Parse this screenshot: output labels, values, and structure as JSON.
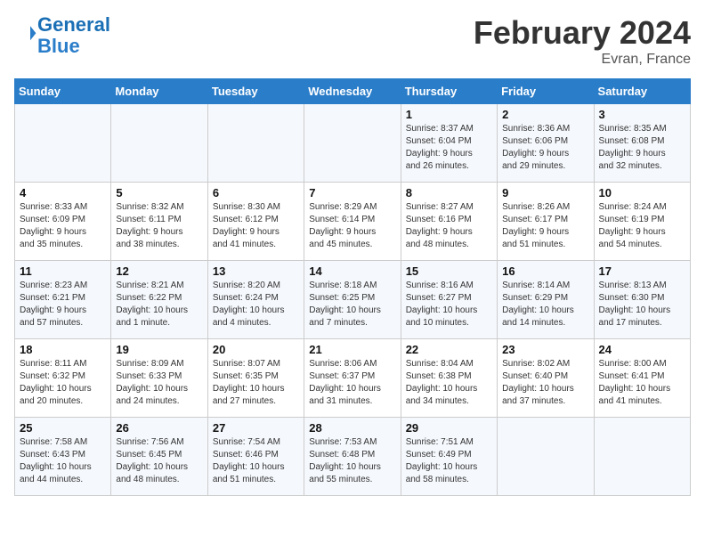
{
  "header": {
    "logo_line1": "General",
    "logo_line2": "Blue",
    "title": "February 2024",
    "subtitle": "Evran, France"
  },
  "columns": [
    "Sunday",
    "Monday",
    "Tuesday",
    "Wednesday",
    "Thursday",
    "Friday",
    "Saturday"
  ],
  "weeks": [
    {
      "days": [
        {
          "num": "",
          "info": ""
        },
        {
          "num": "",
          "info": ""
        },
        {
          "num": "",
          "info": ""
        },
        {
          "num": "",
          "info": ""
        },
        {
          "num": "1",
          "info": "Sunrise: 8:37 AM\nSunset: 6:04 PM\nDaylight: 9 hours\nand 26 minutes."
        },
        {
          "num": "2",
          "info": "Sunrise: 8:36 AM\nSunset: 6:06 PM\nDaylight: 9 hours\nand 29 minutes."
        },
        {
          "num": "3",
          "info": "Sunrise: 8:35 AM\nSunset: 6:08 PM\nDaylight: 9 hours\nand 32 minutes."
        }
      ]
    },
    {
      "days": [
        {
          "num": "4",
          "info": "Sunrise: 8:33 AM\nSunset: 6:09 PM\nDaylight: 9 hours\nand 35 minutes."
        },
        {
          "num": "5",
          "info": "Sunrise: 8:32 AM\nSunset: 6:11 PM\nDaylight: 9 hours\nand 38 minutes."
        },
        {
          "num": "6",
          "info": "Sunrise: 8:30 AM\nSunset: 6:12 PM\nDaylight: 9 hours\nand 41 minutes."
        },
        {
          "num": "7",
          "info": "Sunrise: 8:29 AM\nSunset: 6:14 PM\nDaylight: 9 hours\nand 45 minutes."
        },
        {
          "num": "8",
          "info": "Sunrise: 8:27 AM\nSunset: 6:16 PM\nDaylight: 9 hours\nand 48 minutes."
        },
        {
          "num": "9",
          "info": "Sunrise: 8:26 AM\nSunset: 6:17 PM\nDaylight: 9 hours\nand 51 minutes."
        },
        {
          "num": "10",
          "info": "Sunrise: 8:24 AM\nSunset: 6:19 PM\nDaylight: 9 hours\nand 54 minutes."
        }
      ]
    },
    {
      "days": [
        {
          "num": "11",
          "info": "Sunrise: 8:23 AM\nSunset: 6:21 PM\nDaylight: 9 hours\nand 57 minutes."
        },
        {
          "num": "12",
          "info": "Sunrise: 8:21 AM\nSunset: 6:22 PM\nDaylight: 10 hours\nand 1 minute."
        },
        {
          "num": "13",
          "info": "Sunrise: 8:20 AM\nSunset: 6:24 PM\nDaylight: 10 hours\nand 4 minutes."
        },
        {
          "num": "14",
          "info": "Sunrise: 8:18 AM\nSunset: 6:25 PM\nDaylight: 10 hours\nand 7 minutes."
        },
        {
          "num": "15",
          "info": "Sunrise: 8:16 AM\nSunset: 6:27 PM\nDaylight: 10 hours\nand 10 minutes."
        },
        {
          "num": "16",
          "info": "Sunrise: 8:14 AM\nSunset: 6:29 PM\nDaylight: 10 hours\nand 14 minutes."
        },
        {
          "num": "17",
          "info": "Sunrise: 8:13 AM\nSunset: 6:30 PM\nDaylight: 10 hours\nand 17 minutes."
        }
      ]
    },
    {
      "days": [
        {
          "num": "18",
          "info": "Sunrise: 8:11 AM\nSunset: 6:32 PM\nDaylight: 10 hours\nand 20 minutes."
        },
        {
          "num": "19",
          "info": "Sunrise: 8:09 AM\nSunset: 6:33 PM\nDaylight: 10 hours\nand 24 minutes."
        },
        {
          "num": "20",
          "info": "Sunrise: 8:07 AM\nSunset: 6:35 PM\nDaylight: 10 hours\nand 27 minutes."
        },
        {
          "num": "21",
          "info": "Sunrise: 8:06 AM\nSunset: 6:37 PM\nDaylight: 10 hours\nand 31 minutes."
        },
        {
          "num": "22",
          "info": "Sunrise: 8:04 AM\nSunset: 6:38 PM\nDaylight: 10 hours\nand 34 minutes."
        },
        {
          "num": "23",
          "info": "Sunrise: 8:02 AM\nSunset: 6:40 PM\nDaylight: 10 hours\nand 37 minutes."
        },
        {
          "num": "24",
          "info": "Sunrise: 8:00 AM\nSunset: 6:41 PM\nDaylight: 10 hours\nand 41 minutes."
        }
      ]
    },
    {
      "days": [
        {
          "num": "25",
          "info": "Sunrise: 7:58 AM\nSunset: 6:43 PM\nDaylight: 10 hours\nand 44 minutes."
        },
        {
          "num": "26",
          "info": "Sunrise: 7:56 AM\nSunset: 6:45 PM\nDaylight: 10 hours\nand 48 minutes."
        },
        {
          "num": "27",
          "info": "Sunrise: 7:54 AM\nSunset: 6:46 PM\nDaylight: 10 hours\nand 51 minutes."
        },
        {
          "num": "28",
          "info": "Sunrise: 7:53 AM\nSunset: 6:48 PM\nDaylight: 10 hours\nand 55 minutes."
        },
        {
          "num": "29",
          "info": "Sunrise: 7:51 AM\nSunset: 6:49 PM\nDaylight: 10 hours\nand 58 minutes."
        },
        {
          "num": "",
          "info": ""
        },
        {
          "num": "",
          "info": ""
        }
      ]
    }
  ]
}
